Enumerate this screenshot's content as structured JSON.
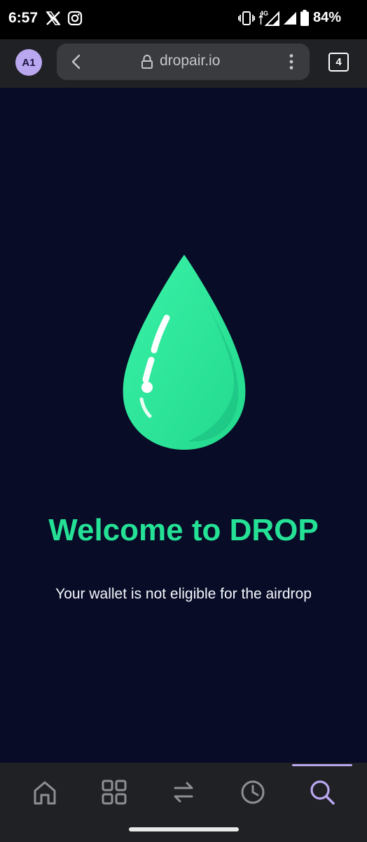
{
  "status_bar": {
    "time": "6:57",
    "network_type": "4G",
    "battery_percent": "84%",
    "notification_icons": [
      "x-icon",
      "instagram-icon"
    ]
  },
  "browser": {
    "profile_initials": "A1",
    "url": "dropair.io",
    "tab_count": "4"
  },
  "page": {
    "title": "Welcome to DROP",
    "message": "Your wallet is not eligible for the airdrop",
    "logo": "water-drop-logo"
  },
  "bottom_nav": {
    "items": [
      "home-icon",
      "grid-icon",
      "swap-icon",
      "history-icon",
      "search-icon"
    ],
    "active": "search"
  },
  "colors": {
    "background": "#080c27",
    "accent": "#25e196",
    "nav_active": "#b9a7f0"
  }
}
